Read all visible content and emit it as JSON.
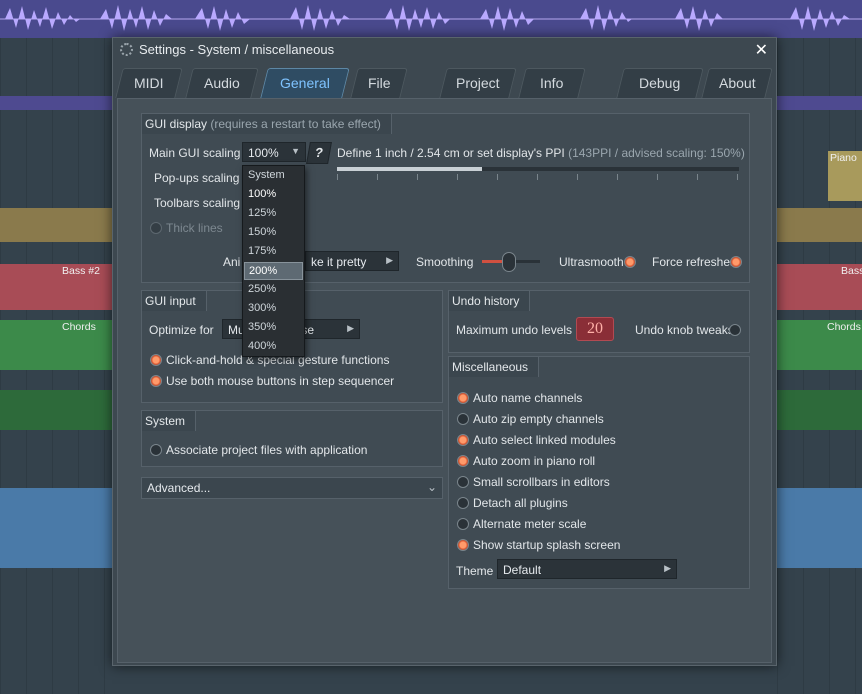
{
  "window": {
    "title": "Settings - System / miscellaneous",
    "close_label": "✕"
  },
  "tabs": [
    {
      "label": "MIDI"
    },
    {
      "label": "Audio"
    },
    {
      "label": "General"
    },
    {
      "label": "File"
    },
    {
      "label": "Project"
    },
    {
      "label": "Info"
    },
    {
      "label": "Debug"
    },
    {
      "label": "About"
    }
  ],
  "active_tab": "General",
  "background": {
    "clips": {
      "bass": "Bass #2",
      "chords": "Chords",
      "piano": "Piano",
      "bass_right": "Bass",
      "chords_right": "Chords"
    }
  },
  "gui_display": {
    "title": "GUI display",
    "title_note": "(requires a restart to take effect)",
    "main_scaling_label": "Main GUI scaling",
    "main_scaling_value": "100%",
    "help_label": "?",
    "ppi_text": "Define 1 inch / 2.54 cm or set display's PPI",
    "ppi_note": "(143PPI / advised scaling: 150%)",
    "popups_label": "Pop-ups scaling",
    "toolbars_label": "Toolbars scaling",
    "thick_lines_label": "Thick lines",
    "animations_label": "Ani",
    "animations_value": "ke it pretty",
    "smoothing_label": "Smoothing",
    "ultrasmooth_label": "Ultrasmooth",
    "force_refreshes_label": "Force refreshes"
  },
  "scaling_menu": {
    "options": [
      "System",
      "100%",
      "125%",
      "150%",
      "175%",
      "200%",
      "250%",
      "300%",
      "350%",
      "400%"
    ],
    "highlighted": "200%",
    "current": "100%"
  },
  "gui_input": {
    "title": "GUI input",
    "optimize_label": "Optimize for",
    "optimize_value_left": "Mu",
    "optimize_value_right": "ouse",
    "click_hold_label": "Click-and-hold & special gesture functions",
    "both_buttons_label": "Use both mouse buttons in step sequencer"
  },
  "system": {
    "title": "System",
    "associate_label": "Associate project files with application"
  },
  "advanced": {
    "label": "Advanced..."
  },
  "undo": {
    "title": "Undo history",
    "max_label": "Maximum undo levels",
    "max_value": "20",
    "knob_label": "Undo knob tweaks"
  },
  "misc": {
    "title": "Miscellaneous",
    "items": [
      {
        "label": "Auto name channels",
        "on": true
      },
      {
        "label": "Auto zip empty channels",
        "on": false
      },
      {
        "label": "Auto select linked modules",
        "on": true
      },
      {
        "label": "Auto zoom in piano roll",
        "on": true
      },
      {
        "label": "Small scrollbars in editors",
        "on": false
      },
      {
        "label": "Detach all plugins",
        "on": false
      },
      {
        "label": "Alternate meter scale",
        "on": false
      },
      {
        "label": "Show startup splash screen",
        "on": true
      }
    ],
    "theme_label": "Theme",
    "theme_value": "Default"
  },
  "colors": {
    "accent": "#7fc3ff",
    "radio_on": "#e0603a",
    "undo_value_bg": "#8a2e37"
  }
}
